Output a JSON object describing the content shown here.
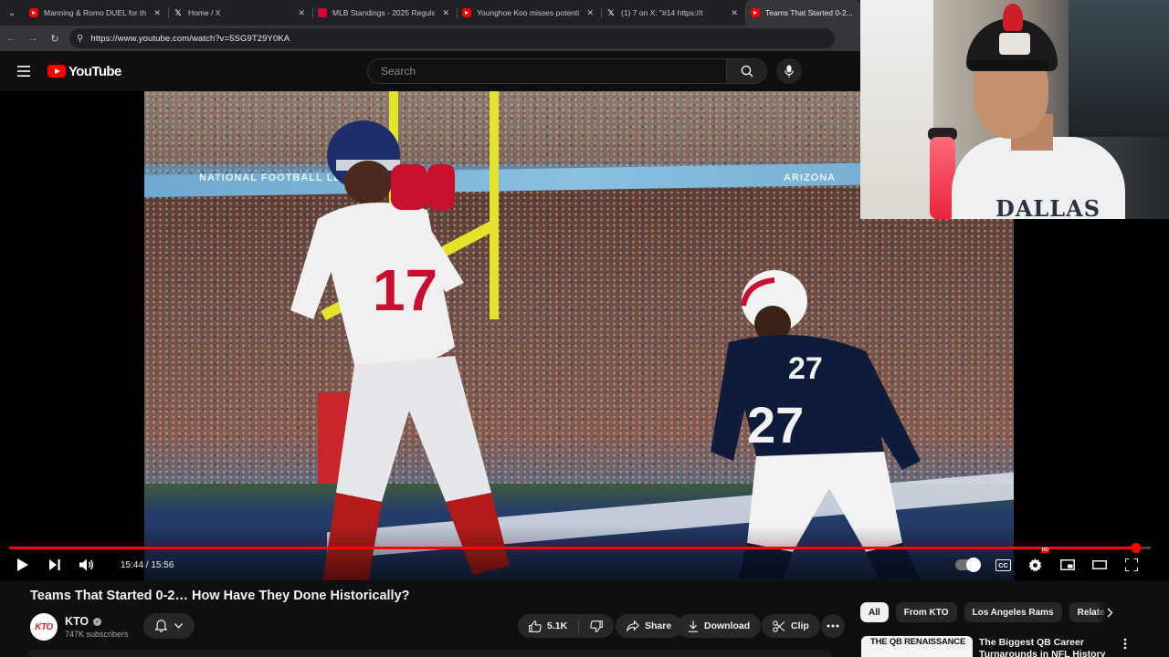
{
  "browser": {
    "tabs": [
      {
        "favicon": "youtube",
        "title": "Manning & Romo DUEL for the",
        "active": false
      },
      {
        "favicon": "x",
        "title": "Home / X",
        "active": false
      },
      {
        "favicon": "mlb",
        "title": "MLB Standings - 2025 Regular",
        "active": false
      },
      {
        "favicon": "youtube",
        "title": "Younghoe Koo misses potentia",
        "active": false
      },
      {
        "favicon": "x",
        "title": "(1) 7     on X: \"#14        https://t",
        "active": false
      },
      {
        "favicon": "youtube",
        "title": "Teams That Started 0-2... H",
        "active": true
      }
    ],
    "url": "https://www.youtube.com/watch?v=5SG9T29Y0KA"
  },
  "masthead": {
    "logo_text": "YouTube",
    "search_placeholder": "Search"
  },
  "player": {
    "time_display": "15:44 / 15:56",
    "progress_fraction": 0.9874,
    "hd_badge": "HD",
    "cc_label": "CC",
    "frame": {
      "banner_left": "NATIONAL FOOTBALL LE",
      "banner_right": "ARIZONA",
      "player1_number": "17",
      "player2_number": "27",
      "colors": {
        "giants_blue": "#1c2f6b",
        "giants_red": "#c8102e",
        "patriots_navy": "#0f1b3a"
      }
    }
  },
  "webcam": {
    "shirt_text": "DALLAS"
  },
  "video": {
    "title": "Teams That Started 0-2… How Have They Done Historically?",
    "channel": {
      "avatar_text": "KTO",
      "name": "KTO",
      "subscribers": "747K subscribers"
    },
    "actions": {
      "likes": "5.1K",
      "share": "Share",
      "download": "Download",
      "clip": "Clip"
    }
  },
  "sidebar": {
    "chips": [
      "All",
      "From KTO",
      "Los Angeles Rams",
      "Relate"
    ],
    "selected_chip": "All",
    "recommendation": {
      "thumb_text": "THE QB RENAISSANCE",
      "title": "The Biggest QB Career Turnarounds in NFL History"
    }
  },
  "colors": {
    "accent_red": "#ff0000",
    "page_bg": "#0f0f0f",
    "pill_bg": "#272727"
  }
}
